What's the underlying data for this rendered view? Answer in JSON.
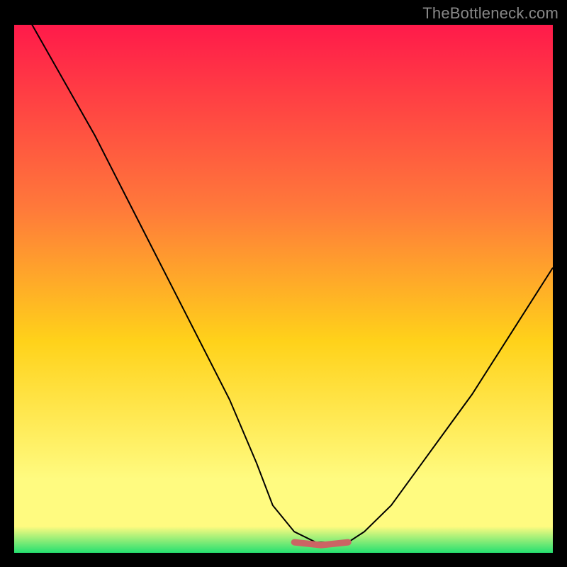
{
  "watermark": "TheBottleneck.com",
  "gradient": {
    "top": "#ff1a4a",
    "mid1": "#ff7a3a",
    "mid2": "#ffd21a",
    "low": "#fffb80",
    "bottom": "#25e070"
  },
  "flat_segment_color": "#cb6464",
  "chart_data": {
    "type": "line",
    "title": "",
    "xlabel": "",
    "ylabel": "",
    "xlim": [
      0,
      100
    ],
    "ylim": [
      0,
      100
    ],
    "series": [
      {
        "name": "bottleneck-curve",
        "x": [
          0,
          5,
          10,
          15,
          20,
          25,
          30,
          35,
          40,
          45,
          48,
          52,
          56,
          60,
          62,
          65,
          70,
          75,
          80,
          85,
          90,
          95,
          100
        ],
        "values": [
          106,
          97,
          88,
          79,
          69,
          59,
          49,
          39,
          29,
          17,
          9,
          4,
          2,
          2,
          2,
          4,
          9,
          16,
          23,
          30,
          38,
          46,
          54
        ]
      }
    ],
    "flat_region": {
      "x_start": 52,
      "x_end": 62,
      "y": 2
    },
    "annotations": []
  }
}
